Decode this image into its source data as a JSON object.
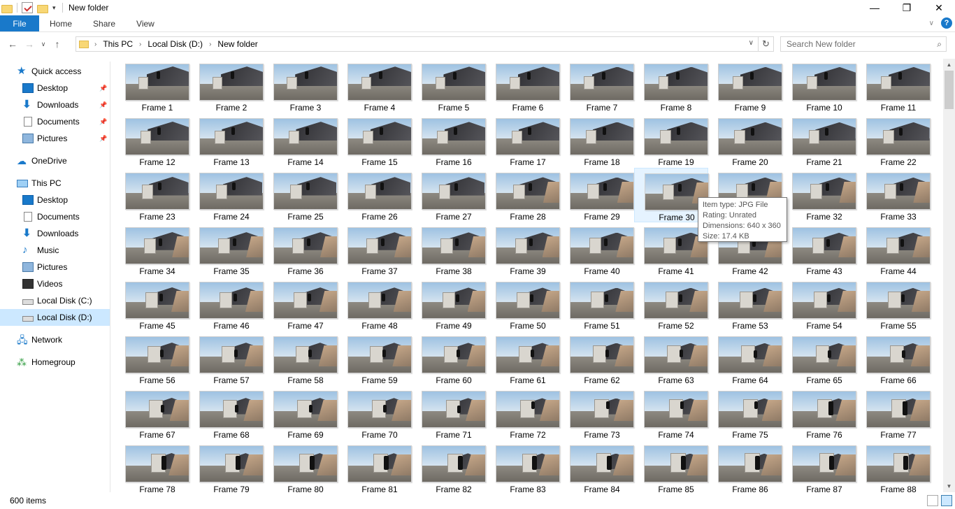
{
  "window": {
    "title": "New folder",
    "minimize": "—",
    "maximize": "❐",
    "close": "✕"
  },
  "ribbon": {
    "tabs": [
      "File",
      "Home",
      "Share",
      "View"
    ],
    "help": "?",
    "expand": "∨"
  },
  "nav": {
    "back": "←",
    "forward": "→",
    "recent": "∨",
    "up": "↑",
    "breadcrumb": [
      "This PC",
      "Local Disk (D:)",
      "New folder"
    ],
    "breadcrumb_sep": "›",
    "dropdown": "∨",
    "refresh": "↻"
  },
  "search": {
    "placeholder": "Search New folder",
    "icon": "⌕"
  },
  "sidebar": {
    "pin": "📌",
    "items": [
      {
        "label": "Quick access",
        "icon": "star-icon",
        "glyph": "★"
      },
      {
        "label": "Desktop",
        "icon": "desktop-icon",
        "pinned": true
      },
      {
        "label": "Downloads",
        "icon": "download-icon",
        "glyph": "⬇",
        "pinned": true
      },
      {
        "label": "Documents",
        "icon": "document-icon",
        "pinned": true
      },
      {
        "label": "Pictures",
        "icon": "pictures-icon",
        "pinned": true
      },
      {
        "label": "OneDrive",
        "icon": "cloud-icon",
        "glyph": "☁"
      },
      {
        "label": "This PC",
        "icon": "computer-icon"
      },
      {
        "label": "Desktop",
        "icon": "desktop-icon"
      },
      {
        "label": "Documents",
        "icon": "document-icon"
      },
      {
        "label": "Downloads",
        "icon": "download-icon",
        "glyph": "⬇"
      },
      {
        "label": "Music",
        "icon": "music-icon",
        "glyph": "♪"
      },
      {
        "label": "Pictures",
        "icon": "pictures-icon"
      },
      {
        "label": "Videos",
        "icon": "video-icon"
      },
      {
        "label": "Local Disk (C:)",
        "icon": "drive-icon"
      },
      {
        "label": "Local Disk (D:)",
        "icon": "drive-icon",
        "selected": true
      },
      {
        "label": "Network",
        "icon": "network-icon",
        "glyph": "🖧"
      },
      {
        "label": "Homegroup",
        "icon": "homegroup-icon",
        "glyph": "⁂"
      }
    ]
  },
  "files": {
    "prefix": "Frame",
    "first": 1,
    "visible_count": 88,
    "columns": 11,
    "hovered": 30
  },
  "tooltip": {
    "lines": [
      "Item type: JPG File",
      "Rating: Unrated",
      "Dimensions: 640 x 360",
      "Size: 17.4 KB"
    ]
  },
  "scrollbar": {
    "up": "▲",
    "down": "▼"
  },
  "status": {
    "item_count": "600 items"
  },
  "colors": {
    "accent": "#1979ca",
    "selection": "#cce8ff",
    "hover": "#e5f3ff"
  }
}
